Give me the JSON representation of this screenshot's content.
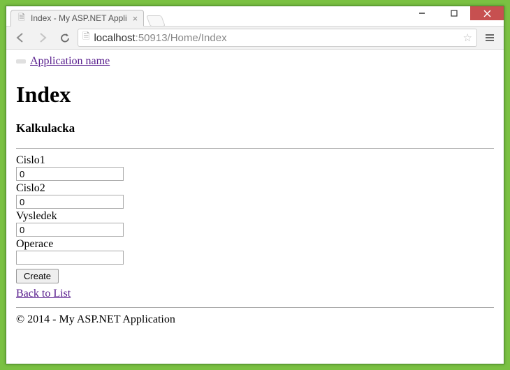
{
  "window": {
    "tab_title": "Index - My ASP.NET Appli",
    "controls": {
      "min": "–",
      "max": "▢",
      "close": "✕"
    }
  },
  "toolbar": {
    "url_host": "localhost",
    "url_path": ":50913/Home/Index"
  },
  "page": {
    "app_link": "Application name",
    "heading": "Index",
    "subheading": "Kalkulacka",
    "fields": {
      "cislo1_label": "Cislo1",
      "cislo1_value": "0",
      "cislo2_label": "Cislo2",
      "cislo2_value": "0",
      "vysledek_label": "Vysledek",
      "vysledek_value": "0",
      "operace_label": "Operace",
      "operace_value": ""
    },
    "create_label": "Create",
    "back_label": "Back to List",
    "footer": "© 2014 - My ASP.NET Application"
  }
}
